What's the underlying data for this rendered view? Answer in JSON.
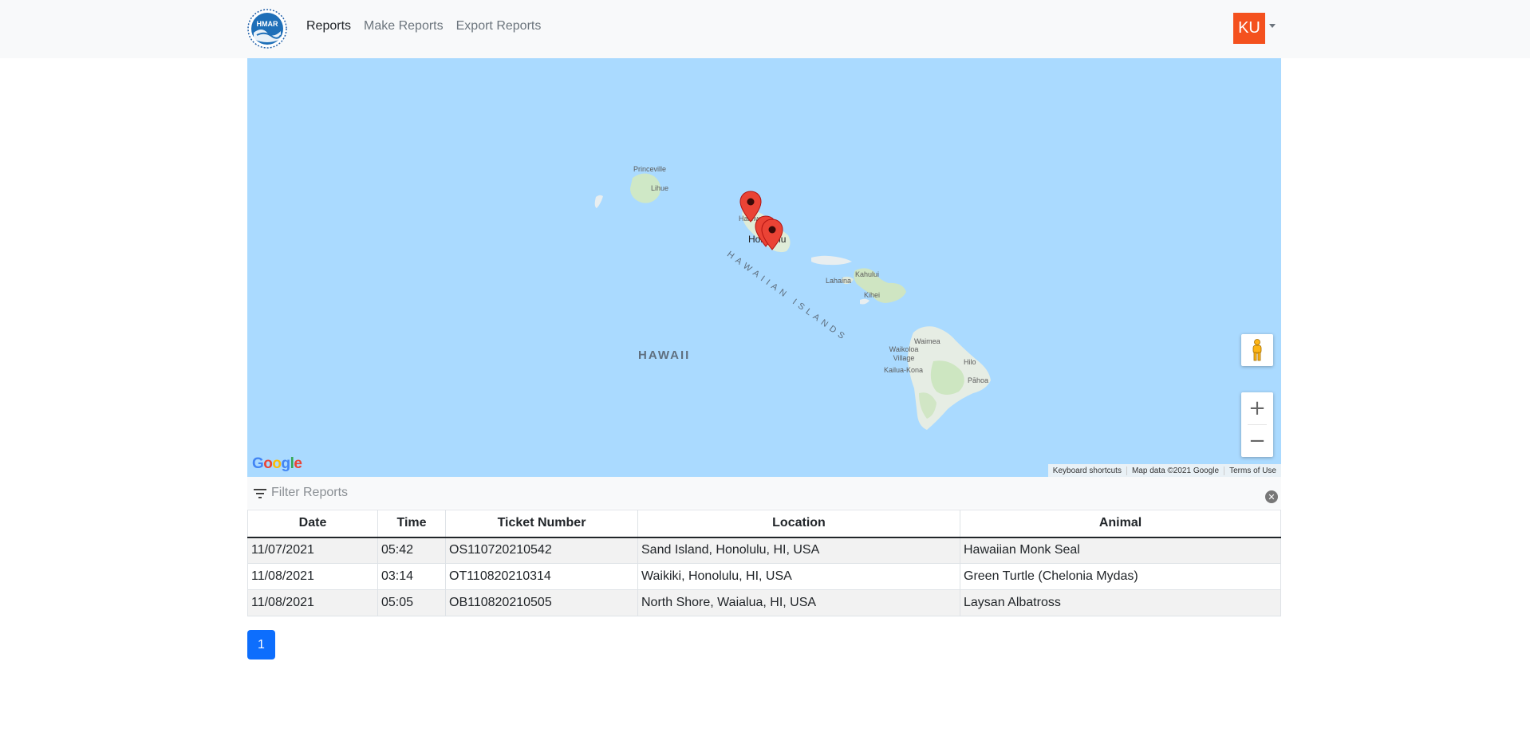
{
  "nav": {
    "logo_text": "HMAR",
    "links": [
      {
        "label": "Reports",
        "active": true
      },
      {
        "label": "Make Reports",
        "active": false
      },
      {
        "label": "Export Reports",
        "active": false
      }
    ],
    "avatar_initials": "KU",
    "avatar_color": "#f4511e"
  },
  "map": {
    "labels": {
      "princeville": "Princeville",
      "lihue": "Lihue",
      "haleiwa": "Haleiwa",
      "honolulu": "Honolulu",
      "kahului": "Kahului",
      "lahaina": "Lahaina",
      "kihei": "Kihei",
      "waimea": "Waimea",
      "waikoloa": "Waikoloa Village",
      "kailua_kona": "Kailua-Kona",
      "hilo": "Hilo",
      "pahoa": "Pāhoa",
      "hawaii_region": "HAWAII",
      "hawaiian_islands": "HAWAIIAN ISLANDS"
    },
    "google_logo": "Google",
    "attribution": {
      "shortcuts": "Keyboard shortcuts",
      "map_data": "Map data ©2021 Google",
      "terms": "Terms of Use"
    },
    "marker_color": "#ea4335",
    "water_color": "#aadaff"
  },
  "filter": {
    "placeholder": "Filter Reports",
    "value": ""
  },
  "table": {
    "headers": [
      "Date",
      "Time",
      "Ticket Number",
      "Location",
      "Animal"
    ],
    "rows": [
      [
        "11/07/2021",
        "05:42",
        "OS110720210542",
        "Sand Island, Honolulu, HI, USA",
        "Hawaiian Monk Seal"
      ],
      [
        "11/08/2021",
        "03:14",
        "OT110820210314",
        "Waikiki, Honolulu, HI, USA",
        "Green Turtle (Chelonia Mydas)"
      ],
      [
        "11/08/2021",
        "05:05",
        "OB110820210505",
        "North Shore, Waialua, HI, USA",
        "Laysan Albatross"
      ]
    ]
  },
  "pagination": {
    "current_page": "1",
    "active_color": "#0d6efd"
  }
}
